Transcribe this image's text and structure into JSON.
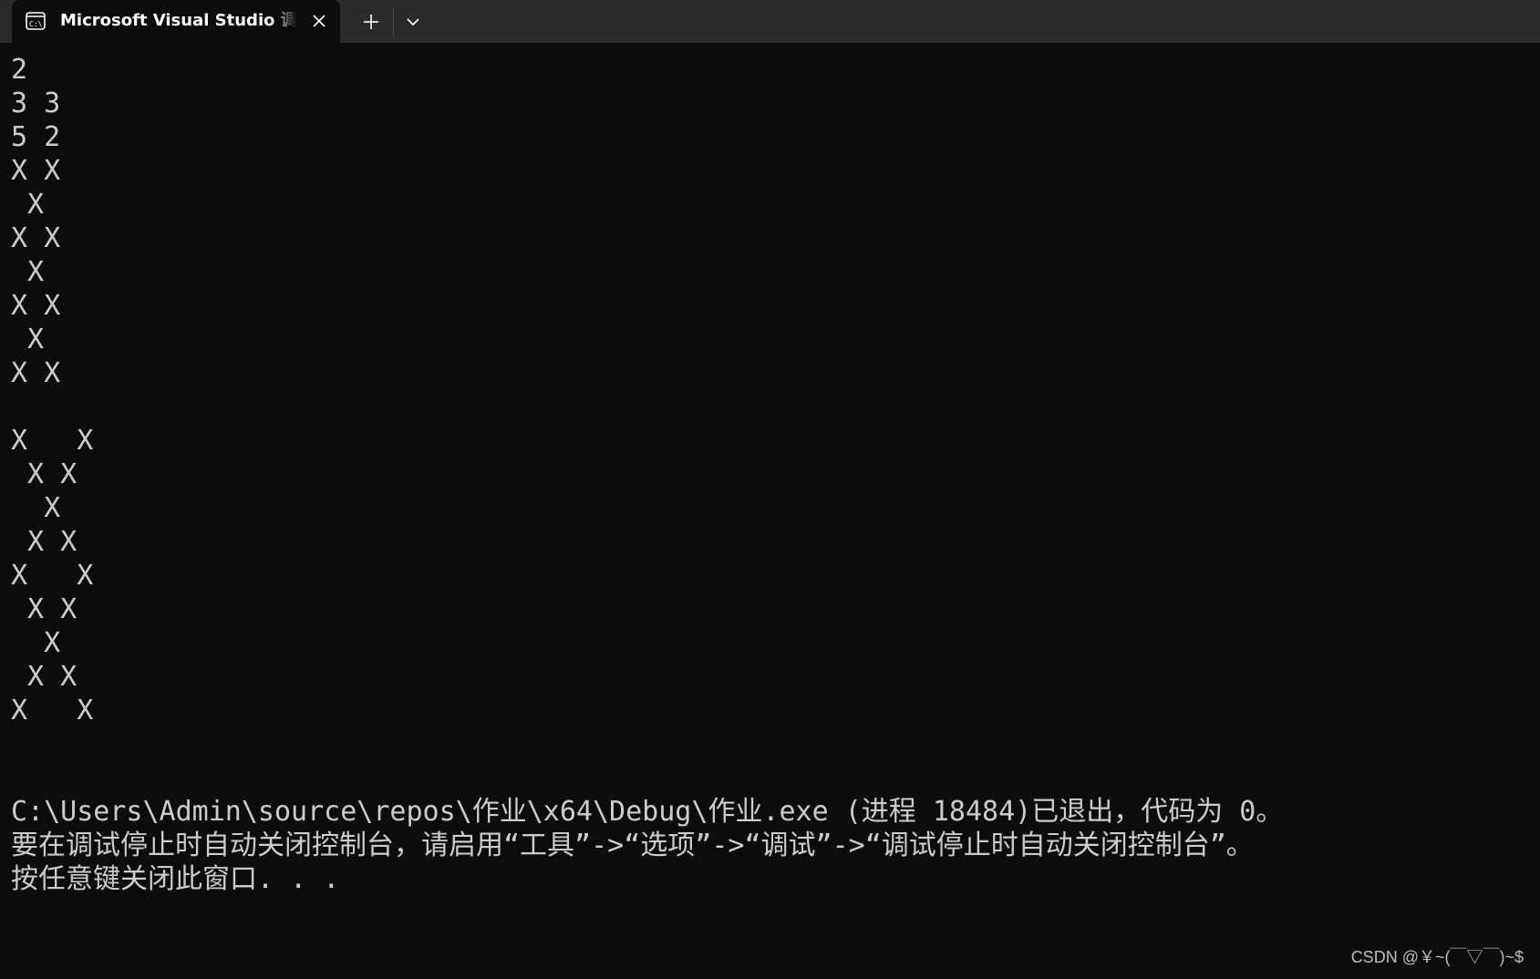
{
  "tab": {
    "title": "Microsoft Visual Studio 调试控制台",
    "icon": "console-icon"
  },
  "toolbar": {
    "close_icon": "close-icon",
    "new_tab_icon": "plus-icon",
    "dropdown_icon": "chevron-down-icon"
  },
  "console": {
    "output_lines": [
      "2",
      "3 3",
      "5 2",
      "X X",
      " X",
      "X X",
      " X",
      "X X",
      " X",
      "X X",
      "",
      "X   X",
      " X X",
      "  X",
      " X X",
      "X   X",
      " X X",
      "  X",
      " X X",
      "X   X"
    ],
    "exit_message": "C:\\Users\\Admin\\source\\repos\\作业\\x64\\Debug\\作业.exe (进程 18484)已退出，代码为 0。",
    "hint_message": "要在调试停止时自动关闭控制台，请启用“工具”->“选项”->“调试”->“调试停止时自动关闭控制台”。",
    "press_key_message": "按任意键关闭此窗口. . ."
  },
  "watermark": "CSDN @￥~(￣▽￣)~$"
}
